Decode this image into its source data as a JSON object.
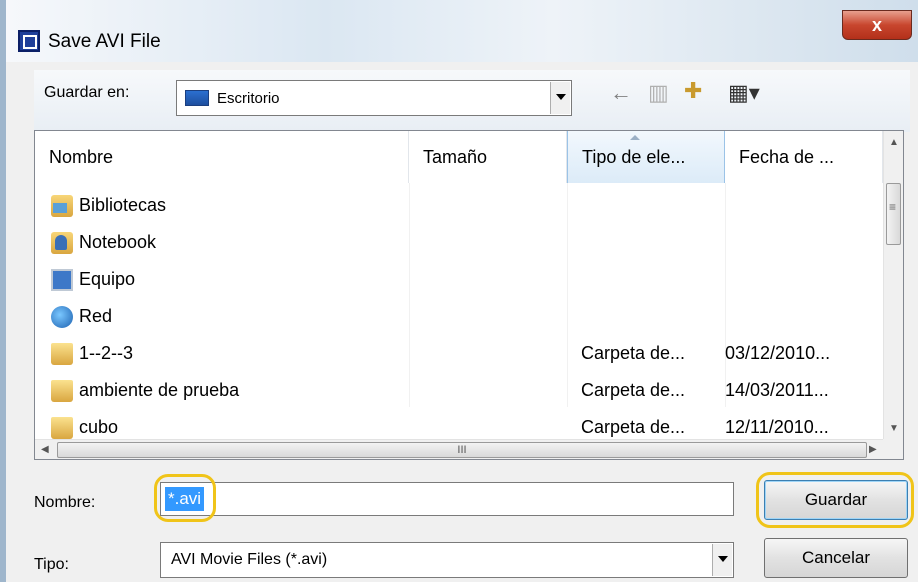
{
  "window": {
    "title": "Save AVI File",
    "close_label": "x"
  },
  "lookin": {
    "label": "Guardar en:",
    "value": "Escritorio"
  },
  "toolbar": {
    "back": "←",
    "up": "▥",
    "new_folder": "✚",
    "view": "▦▾"
  },
  "list": {
    "columns": [
      "Nombre",
      "Tamaño",
      "Tipo de ele...",
      "Fecha de ..."
    ],
    "rows": [
      {
        "name": "Bibliotecas",
        "type": "",
        "date": "",
        "icon": "libraries-icon"
      },
      {
        "name": "Notebook",
        "type": "",
        "date": "",
        "icon": "user-folder-icon"
      },
      {
        "name": "Equipo",
        "type": "",
        "date": "",
        "icon": "computer-icon"
      },
      {
        "name": "Red",
        "type": "",
        "date": "",
        "icon": "network-icon"
      },
      {
        "name": "1--2--3",
        "type": "Carpeta de...",
        "date": "03/12/2010...",
        "icon": "folder-icon"
      },
      {
        "name": "ambiente de prueba",
        "type": "Carpeta de...",
        "date": "14/03/2011...",
        "icon": "folder-icon"
      },
      {
        "name": "cubo",
        "type": "Carpeta de...",
        "date": "12/11/2010...",
        "icon": "folder-icon"
      }
    ],
    "hscroll_grip": "III"
  },
  "filename": {
    "label": "Nombre:",
    "value": "*.avi"
  },
  "filetype": {
    "label": "Tipo:",
    "value": "AVI Movie Files (*.avi)"
  },
  "buttons": {
    "save": "Guardar",
    "cancel": "Cancelar"
  },
  "colors": {
    "selection": "#3399ff",
    "highlight_ring": "#f0c419",
    "close_button": "#c8462e"
  }
}
